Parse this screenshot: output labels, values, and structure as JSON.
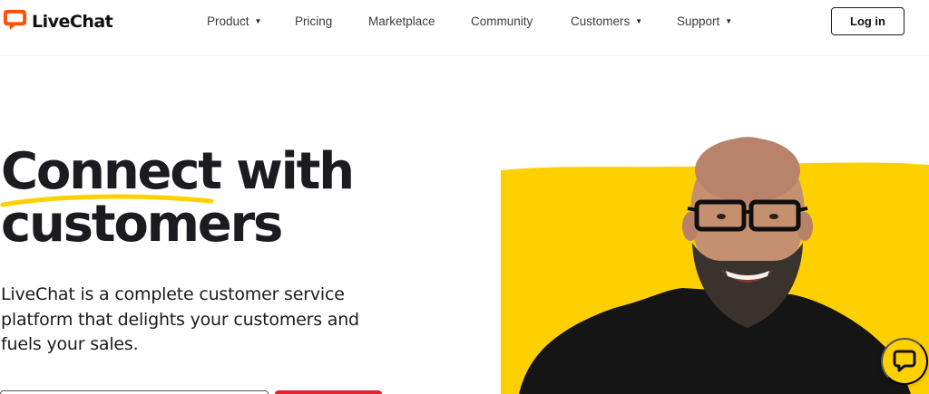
{
  "brand": {
    "name": "LiveChat",
    "color": "#ff5100"
  },
  "nav": {
    "items": [
      {
        "label": "Product",
        "has_dropdown": true
      },
      {
        "label": "Pricing",
        "has_dropdown": false
      },
      {
        "label": "Marketplace",
        "has_dropdown": false
      },
      {
        "label": "Community",
        "has_dropdown": false
      },
      {
        "label": "Customers",
        "has_dropdown": true
      },
      {
        "label": "Support",
        "has_dropdown": true
      }
    ],
    "caret": "▼",
    "login_label": "Log in"
  },
  "hero": {
    "title_line1": "Connect with",
    "title_line2": "customers",
    "description": "LiveChat is a complete customer service platform that delights your customers and fuels your sales."
  },
  "colors": {
    "accent_yellow": "#ffd000",
    "cta_red": "#e8202c",
    "text_dark": "#1b1b20"
  },
  "icons": {
    "logo": "chat-bubble-logo-icon",
    "chat_widget": "chat-bubble-icon"
  }
}
